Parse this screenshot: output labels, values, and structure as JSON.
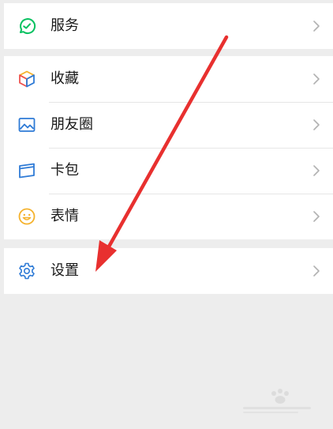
{
  "menu": {
    "services": {
      "label": "服务",
      "icon": "services-check-icon",
      "color": "#07c160"
    },
    "favorites": {
      "label": "收藏",
      "icon": "favorites-cube-icon"
    },
    "moments": {
      "label": "朋友圈",
      "icon": "moments-picture-icon",
      "color": "#2f7bd6"
    },
    "cards": {
      "label": "卡包",
      "icon": "card-wallet-icon",
      "color": "#2f7bd6"
    },
    "stickers": {
      "label": "表情",
      "icon": "smiley-face-icon",
      "color": "#f5b22c"
    },
    "settings": {
      "label": "设置",
      "icon": "gear-icon",
      "color": "#2f7bd6"
    }
  },
  "annotation": {
    "icon": "red-arrow-pointer",
    "color": "#e8302f"
  },
  "watermark": {
    "icon": "baidu-experience-watermark",
    "color": "#cfcfcf"
  }
}
